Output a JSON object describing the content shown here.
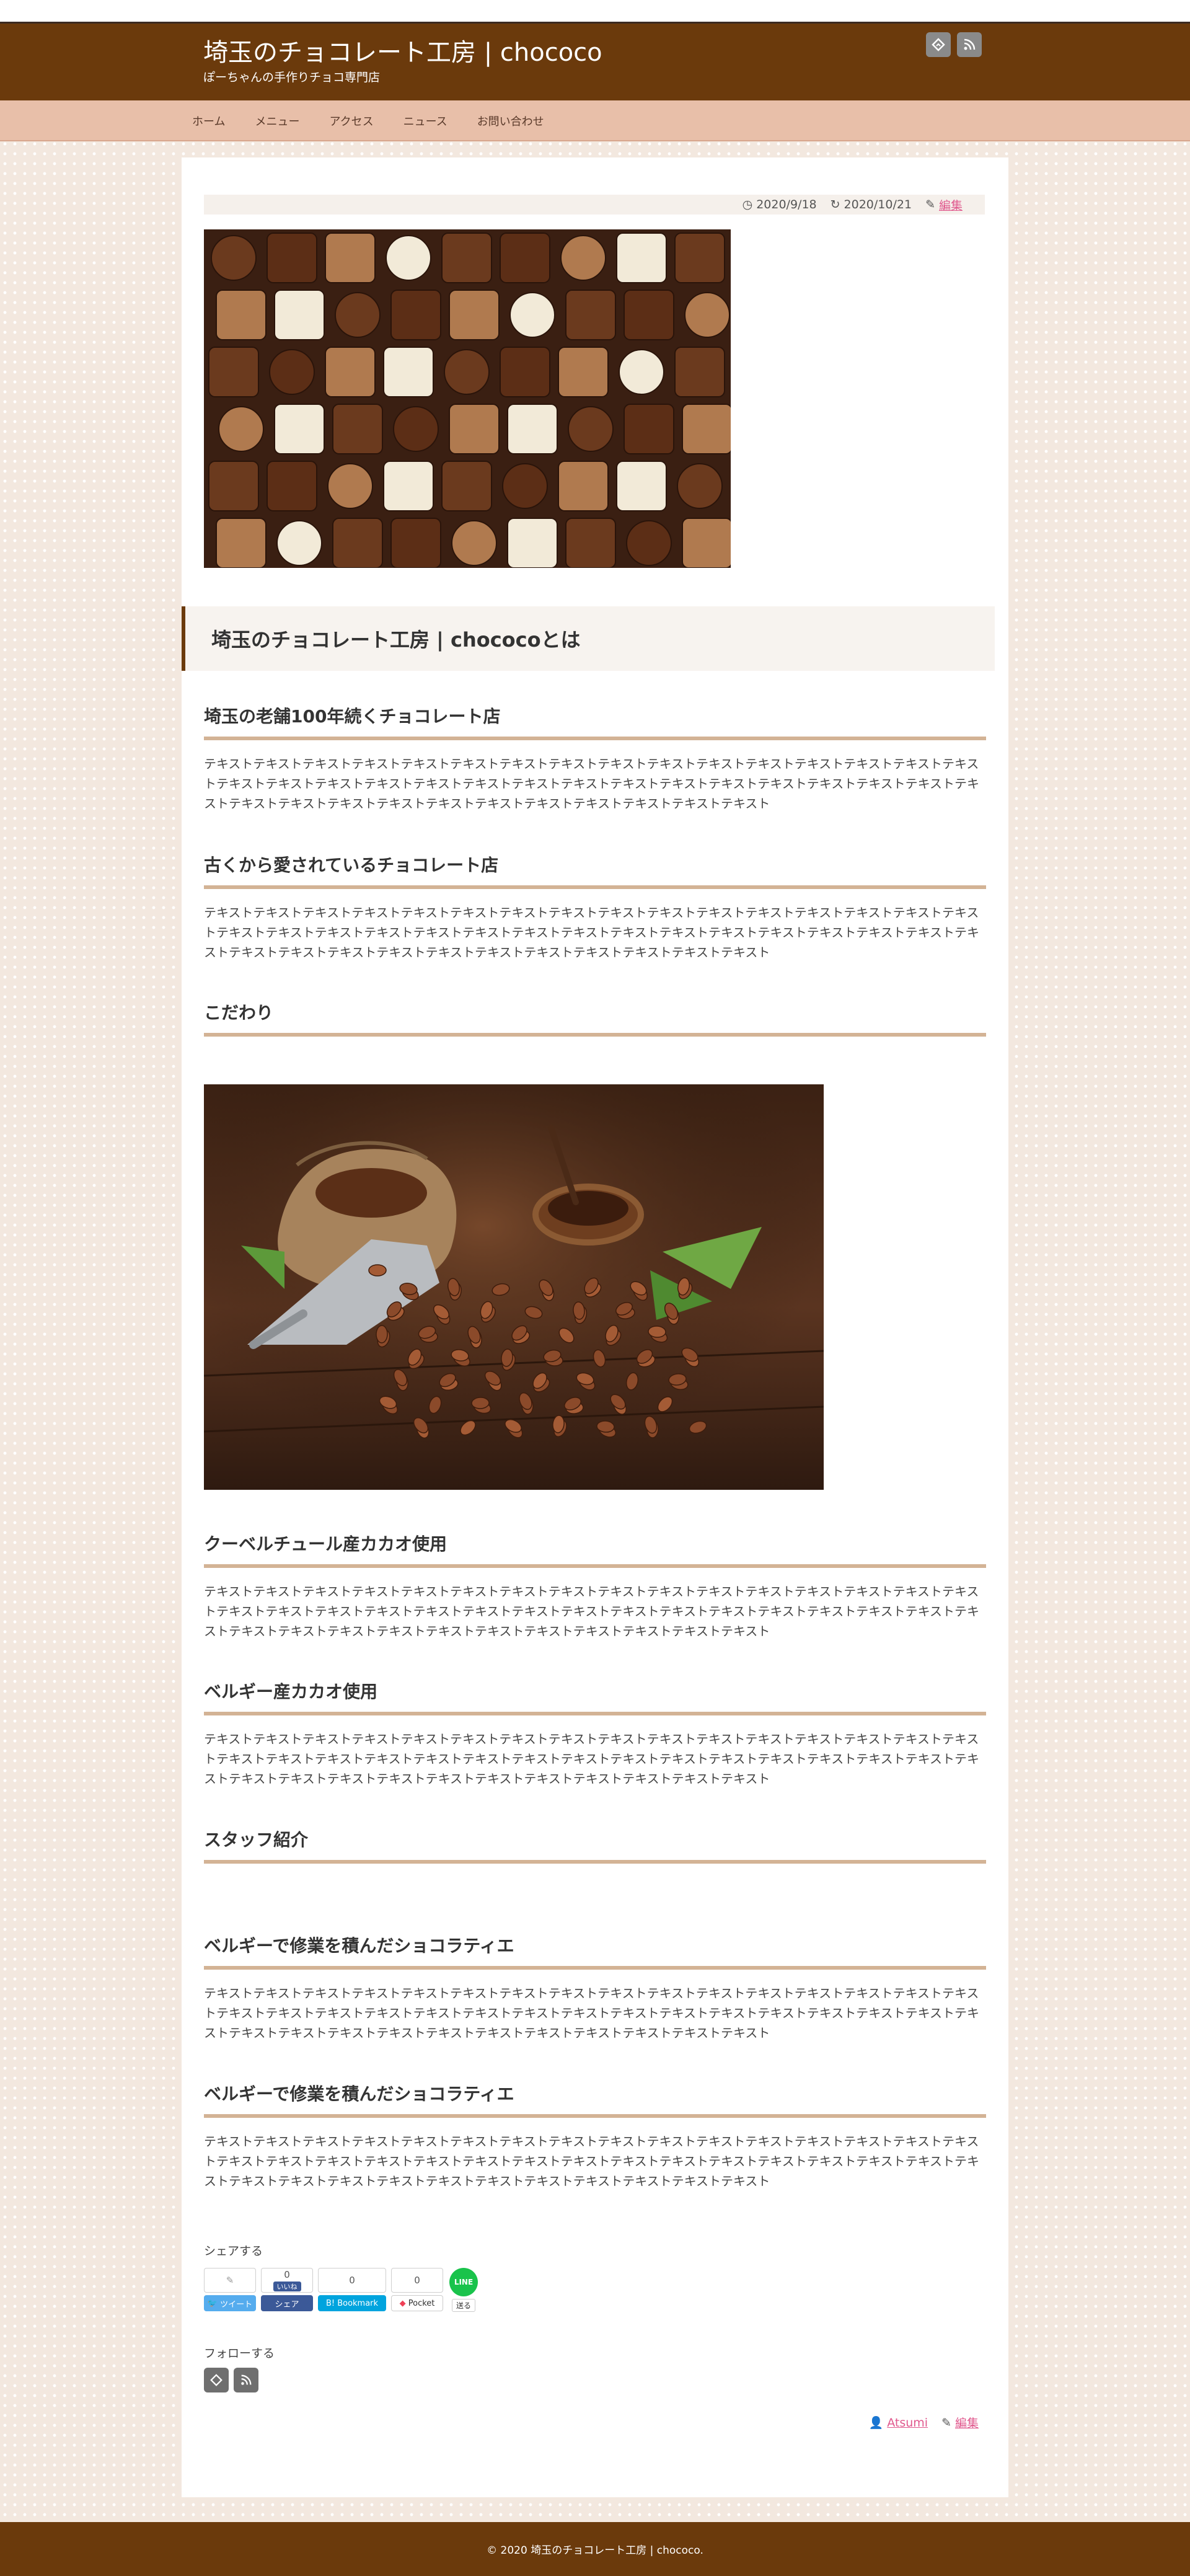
{
  "header": {
    "site_title": "埼玉のチョコレート工房 | chococo",
    "site_description": "ぽーちゃんの手作りチョコ専門店",
    "icons": [
      "feedly-icon",
      "rss-icon"
    ]
  },
  "nav": {
    "items": [
      "ホーム",
      "メニュー",
      "アクセス",
      "ニュース",
      "お問い合わせ"
    ]
  },
  "post_meta": {
    "published": "2020/9/18",
    "updated": "2020/10/21",
    "edit_label": "編集"
  },
  "content": {
    "h2": "埼玉のチョコレート工房 | chococoとは",
    "sections": [
      {
        "heading": "埼玉の老舗100年続くチョコレート店",
        "text": "テキストテキストテキストテキストテキストテキストテキストテキストテキストテキストテキストテキストテキストテキストテキストテキストテキストテキストテキストテキストテキストテキストテキストテキストテキストテキストテキストテキストテキストテキストテキストテキストテキストテキストテキストテキストテキストテキストテキストテキストテキストテキストテキスト"
      },
      {
        "heading": "古くから愛されているチョコレート店",
        "text": "テキストテキストテキストテキストテキストテキストテキストテキストテキストテキストテキストテキストテキストテキストテキストテキストテキストテキストテキストテキストテキストテキストテキストテキストテキストテキストテキストテキストテキストテキストテキストテキストテキストテキストテキストテキストテキストテキストテキストテキストテキストテキストテキスト"
      },
      {
        "heading": "こだわり"
      },
      {
        "heading": "クーベルチュール産カカオ使用",
        "text": "テキストテキストテキストテキストテキストテキストテキストテキストテキストテキストテキストテキストテキストテキストテキストテキストテキストテキストテキストテキストテキストテキストテキストテキストテキストテキストテキストテキストテキストテキストテキストテキストテキストテキストテキストテキストテキストテキストテキストテキストテキストテキストテキスト"
      },
      {
        "heading": "ベルギー産カカオ使用",
        "text": "テキストテキストテキストテキストテキストテキストテキストテキストテキストテキストテキストテキストテキストテキストテキストテキストテキストテキストテキストテキストテキストテキストテキストテキストテキストテキストテキストテキストテキストテキストテキストテキストテキストテキストテキストテキストテキストテキストテキストテキストテキストテキストテキスト"
      },
      {
        "heading": "スタッフ紹介"
      },
      {
        "heading": "ベルギーで修業を積んだショコラティエ",
        "text": "テキストテキストテキストテキストテキストテキストテキストテキストテキストテキストテキストテキストテキストテキストテキストテキストテキストテキストテキストテキストテキストテキストテキストテキストテキストテキストテキストテキストテキストテキストテキストテキストテキストテキストテキストテキストテキストテキストテキストテキストテキストテキストテキスト"
      },
      {
        "heading": "ベルギーで修業を積んだショコラティエ",
        "text": "テキストテキストテキストテキストテキストテキストテキストテキストテキストテキストテキストテキストテキストテキストテキストテキストテキストテキストテキストテキストテキストテキストテキストテキストテキストテキストテキストテキストテキストテキストテキストテキストテキストテキストテキストテキストテキストテキストテキストテキストテキストテキストテキスト"
      }
    ]
  },
  "share": {
    "label": "シェアする",
    "twitter": {
      "count": "",
      "label": "ツイート"
    },
    "facebook": {
      "count": "0",
      "label": "シェア",
      "like": "いいね"
    },
    "hatena": {
      "count": "0",
      "label": "B! Bookmark"
    },
    "pocket": {
      "count": "0",
      "label": "Pocket"
    },
    "line": {
      "icon_text": "LINE",
      "label": "送る"
    }
  },
  "follow": {
    "label": "フォローする"
  },
  "author": {
    "name": "Atsumi",
    "edit_label": "編集"
  },
  "footer": {
    "copyright": "© 2020 埼玉のチョコレート工房 | chococo."
  },
  "colors": {
    "header_bg": "#6b3a0c",
    "nav_bg": "#e8bfa9",
    "heading_underline": "#d3b395",
    "link": "#e0588d"
  }
}
